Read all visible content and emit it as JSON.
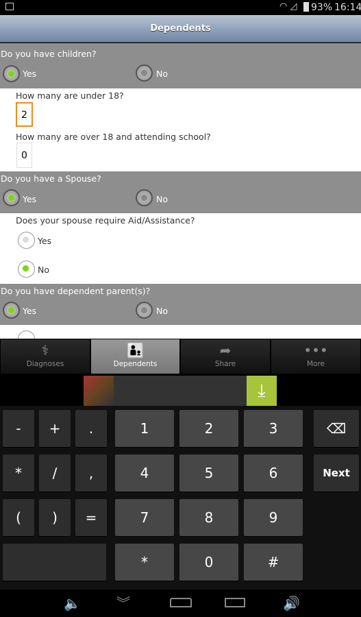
{
  "status": {
    "battery": "93%",
    "time": "16:14"
  },
  "header": {
    "title": "Dependents"
  },
  "form": {
    "children": {
      "question": "Do you have children?",
      "yes": "Yes",
      "no": "No",
      "selected": "Yes"
    },
    "under18": {
      "label": "How many are under 18?",
      "value": "2"
    },
    "over18": {
      "label": "How many are over 18 and attending school?",
      "value": "0"
    },
    "spouse": {
      "question": "Do you have a Spouse?",
      "yes": "Yes",
      "no": "No",
      "selected": "Yes"
    },
    "spouse_aid": {
      "question": "Does your spouse require Aid/Assistance?",
      "yes": "Yes",
      "no": "No",
      "selected": "No"
    },
    "parents": {
      "question": "Do you have dependent parent(s)?",
      "yes": "Yes",
      "no": "No",
      "selected": "Yes"
    }
  },
  "tabs": [
    {
      "label": "Diagnoses",
      "icon": "caduceus-icon"
    },
    {
      "label": "Dependents",
      "icon": "parent-child-icon",
      "active": true
    },
    {
      "label": "Share",
      "icon": "share-icon"
    },
    {
      "label": "More",
      "icon": "more-icon"
    }
  ],
  "keyboard": {
    "symbols": [
      "-",
      "+",
      ".",
      "*",
      "/",
      ",",
      "(",
      ")",
      "="
    ],
    "digits": [
      "1",
      "2",
      "3",
      "4",
      "5",
      "6",
      "7",
      "8",
      "9",
      "*",
      "0",
      "#"
    ],
    "next": "Next"
  },
  "colors": {
    "accent": "#7ed321",
    "ad_download": "#a8c43a",
    "focus": "#f08a1c"
  }
}
